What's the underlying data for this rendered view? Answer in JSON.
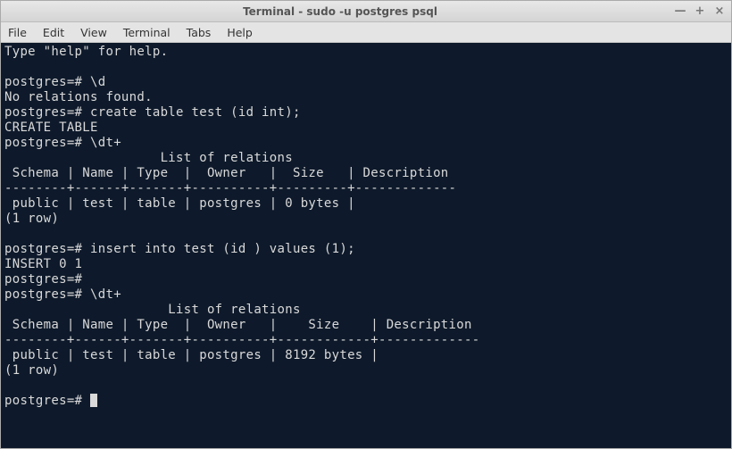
{
  "window": {
    "title": "Terminal - sudo -u postgres psql"
  },
  "titlebar_buttons": {
    "minimize": "—",
    "maximize": "+",
    "close": "×"
  },
  "menu": {
    "file": "File",
    "edit": "Edit",
    "view": "View",
    "terminal": "Terminal",
    "tabs": "Tabs",
    "help": "Help"
  },
  "terminal": {
    "line01": "Type \"help\" for help.",
    "line02": "",
    "line03": "postgres=# \\d",
    "line04": "No relations found.",
    "line05": "postgres=# create table test (id int);",
    "line06": "CREATE TABLE",
    "line07": "postgres=# \\dt+",
    "line08": "                    List of relations",
    "line09": " Schema | Name | Type  |  Owner   |  Size   | Description ",
    "line10": "--------+------+-------+----------+---------+-------------",
    "line11": " public | test | table | postgres | 0 bytes | ",
    "line12": "(1 row)",
    "line13": "",
    "line14": "postgres=# insert into test (id ) values (1);",
    "line15": "INSERT 0 1",
    "line16": "postgres=# ",
    "line17": "postgres=# \\dt+",
    "line18": "                     List of relations",
    "line19": " Schema | Name | Type  |  Owner   |    Size    | Description ",
    "line20": "--------+------+-------+----------+------------+-------------",
    "line21": " public | test | table | postgres | 8192 bytes | ",
    "line22": "(1 row)",
    "line23": "",
    "line24": "postgres=# "
  }
}
